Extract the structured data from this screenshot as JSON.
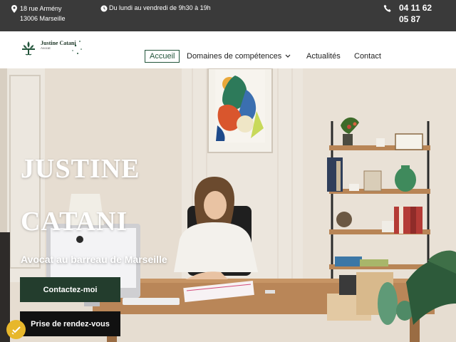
{
  "topbar": {
    "address_line1": "18 rue Armény",
    "address_line2": "13006 Marseille",
    "hours": "Du lundi au vendredi de 9h30 à 19h",
    "phone_line1": "04 11 62",
    "phone_line2": "05 87"
  },
  "logo": {
    "name": "Justine Catani",
    "subtitle": "Avocat"
  },
  "nav": {
    "home": "Accueil",
    "domains": "Domaines de compétences",
    "news": "Actualités",
    "contact": "Contact"
  },
  "hero": {
    "title_line1": "JUSTINE",
    "title_line2": "CATANI",
    "subtitle": "Avocat au barreau de Marseille",
    "contact_button": "Contactez-moi",
    "appointment_button": "Prise de rendez-vous"
  },
  "icons": {
    "location": "map-pin-icon",
    "hours": "clock-icon",
    "phone": "phone-icon",
    "dropdown": "chevron-down-icon",
    "badge": "accessibility-badge-icon"
  },
  "colors": {
    "topbar": "#3a3a3a",
    "brand_green": "#233d2d",
    "dark_button": "#111111",
    "badge_yellow": "#e7b72b"
  }
}
